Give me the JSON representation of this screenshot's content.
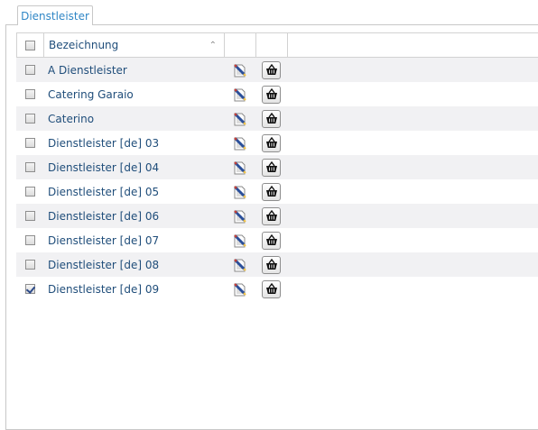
{
  "tab": {
    "label": "Dienstleister"
  },
  "table": {
    "header": {
      "name": "Bezeichnung",
      "sort_indicator": "^"
    },
    "rows": [
      {
        "name": "A Dienstleister",
        "checked": false
      },
      {
        "name": "Catering Garaio",
        "checked": false
      },
      {
        "name": "Caterino",
        "checked": false
      },
      {
        "name": "Dienstleister [de] 03",
        "checked": false
      },
      {
        "name": "Dienstleister [de] 04",
        "checked": false
      },
      {
        "name": "Dienstleister [de] 05",
        "checked": false
      },
      {
        "name": "Dienstleister [de] 06",
        "checked": false
      },
      {
        "name": "Dienstleister [de] 07",
        "checked": false
      },
      {
        "name": "Dienstleister [de] 08",
        "checked": false
      },
      {
        "name": "Dienstleister [de] 09",
        "checked": true
      }
    ]
  },
  "icons": {
    "edit": "edit-document-pencil-icon",
    "delete": "basket-delete-icon"
  },
  "colors": {
    "link": "#1f4d7a",
    "tab_label": "#2f86c6",
    "row_alt": "#f1f1f3",
    "border": "#d2d2d2"
  }
}
